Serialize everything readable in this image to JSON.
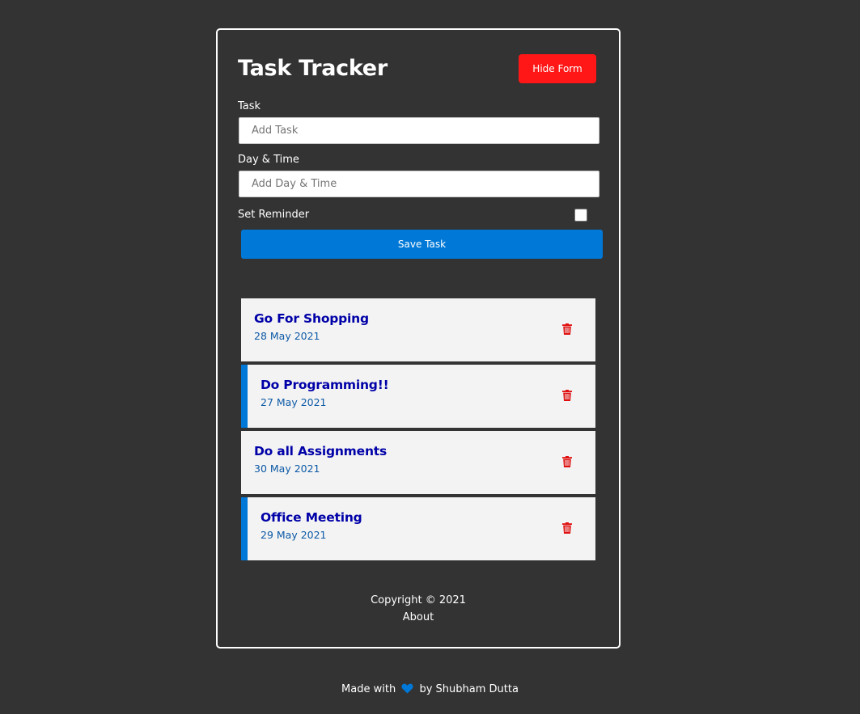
{
  "header": {
    "title": "Task Tracker",
    "toggle_label": "Hide Form"
  },
  "form": {
    "task_label": "Task",
    "task_placeholder": "Add Task",
    "task_value": "",
    "daytime_label": "Day & Time",
    "daytime_placeholder": "Add Day & Time",
    "daytime_value": "",
    "reminder_label": "Set Reminder",
    "reminder_checked": false,
    "submit_label": "Save Task"
  },
  "tasks": [
    {
      "text": "Go For Shopping",
      "day": "28 May 2021",
      "reminder": false
    },
    {
      "text": "Do Programming!!",
      "day": "27 May 2021",
      "reminder": true
    },
    {
      "text": "Do all Assignments",
      "day": "30 May 2021",
      "reminder": false
    },
    {
      "text": "Office Meeting",
      "day": "29 May 2021",
      "reminder": true
    }
  ],
  "footer": {
    "copyright": "Copyright © 2021",
    "about_link": "About"
  },
  "credit": {
    "prefix": "Made with",
    "suffix": "by Shubham Dutta"
  },
  "colors": {
    "background": "#333333",
    "hide_button": "#ff1717",
    "save_button": "#0078d7",
    "task_title": "#0000a8",
    "task_date": "#0d5aa7",
    "trash_icon": "#e01010",
    "reminder_border": "#0078d7",
    "heart": "#0078d7"
  }
}
